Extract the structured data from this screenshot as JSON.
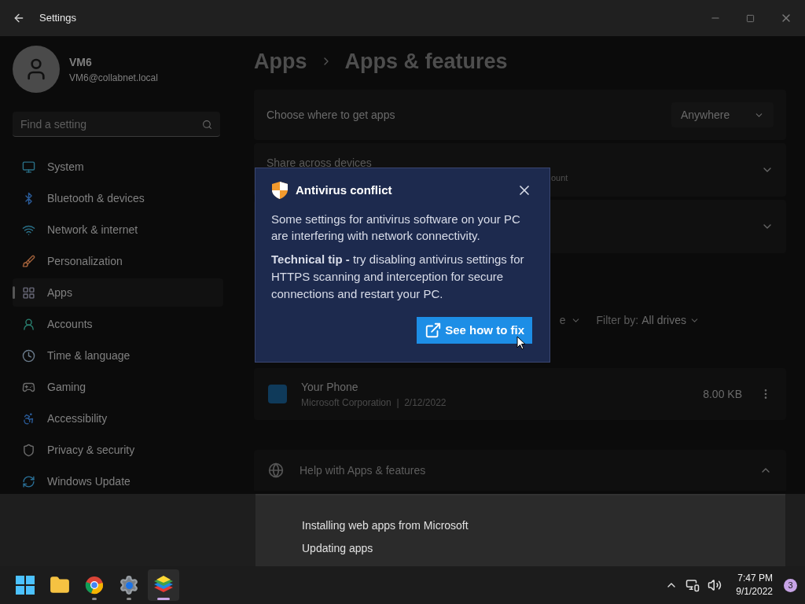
{
  "window": {
    "title": "Settings"
  },
  "user": {
    "name": "VM6",
    "email": "VM6@collabnet.local"
  },
  "search": {
    "placeholder": "Find a setting"
  },
  "nav": [
    {
      "label": "System",
      "kind": "system",
      "selected": false
    },
    {
      "label": "Bluetooth & devices",
      "kind": "bluetooth",
      "selected": false
    },
    {
      "label": "Network & internet",
      "kind": "network",
      "selected": false
    },
    {
      "label": "Personalization",
      "kind": "brush",
      "selected": false
    },
    {
      "label": "Apps",
      "kind": "apps",
      "selected": true
    },
    {
      "label": "Accounts",
      "kind": "person",
      "selected": false
    },
    {
      "label": "Time & language",
      "kind": "clock",
      "selected": false
    },
    {
      "label": "Gaming",
      "kind": "gamepad",
      "selected": false
    },
    {
      "label": "Accessibility",
      "kind": "accessibility",
      "selected": false
    },
    {
      "label": "Privacy & security",
      "kind": "shield",
      "selected": false
    },
    {
      "label": "Windows Update",
      "kind": "update",
      "selected": false
    }
  ],
  "breadcrumb": [
    "Apps",
    "Apps & features"
  ],
  "settings": [
    {
      "kind": "dropdown",
      "label": "Choose where to get apps",
      "value": "Anywhere"
    },
    {
      "kind": "expander",
      "label": "Share across devices",
      "sub": "ount",
      "expanded": false
    },
    {
      "kind": "expander",
      "expanded": false
    }
  ],
  "filters": {
    "sort_fragment": "e",
    "filter_label": "Filter by:",
    "filter_value": "All drives"
  },
  "apps": [
    {
      "name": "Your Phone",
      "publisher": "Microsoft Corporation",
      "date": "2/12/2022",
      "separator": "|",
      "size": "8.00 KB"
    }
  ],
  "help": {
    "title": "Help with Apps & features",
    "expanded": true,
    "links": [
      "Installing web apps from Microsoft",
      "Updating apps"
    ]
  },
  "popup": {
    "title": "Antivirus conflict",
    "body": "Some settings for antivirus software on your PC are interfering with network connectivity.",
    "tip": "**Technical tip -** try disabling antivirus settings for HTTPS scanning and interception for secure connections and restart your PC.",
    "button": "See how to fix"
  },
  "taskbar": {
    "apps": [
      {
        "kind": "start",
        "running": false,
        "active": false
      },
      {
        "kind": "folder",
        "running": false,
        "active": false
      },
      {
        "kind": "browser",
        "running": true,
        "active": false
      },
      {
        "kind": "gear",
        "running": true,
        "active": false
      },
      {
        "kind": "stack",
        "running": true,
        "active": true
      }
    ],
    "time": "7:47 PM",
    "date": "9/1/2022",
    "badge": "3"
  }
}
